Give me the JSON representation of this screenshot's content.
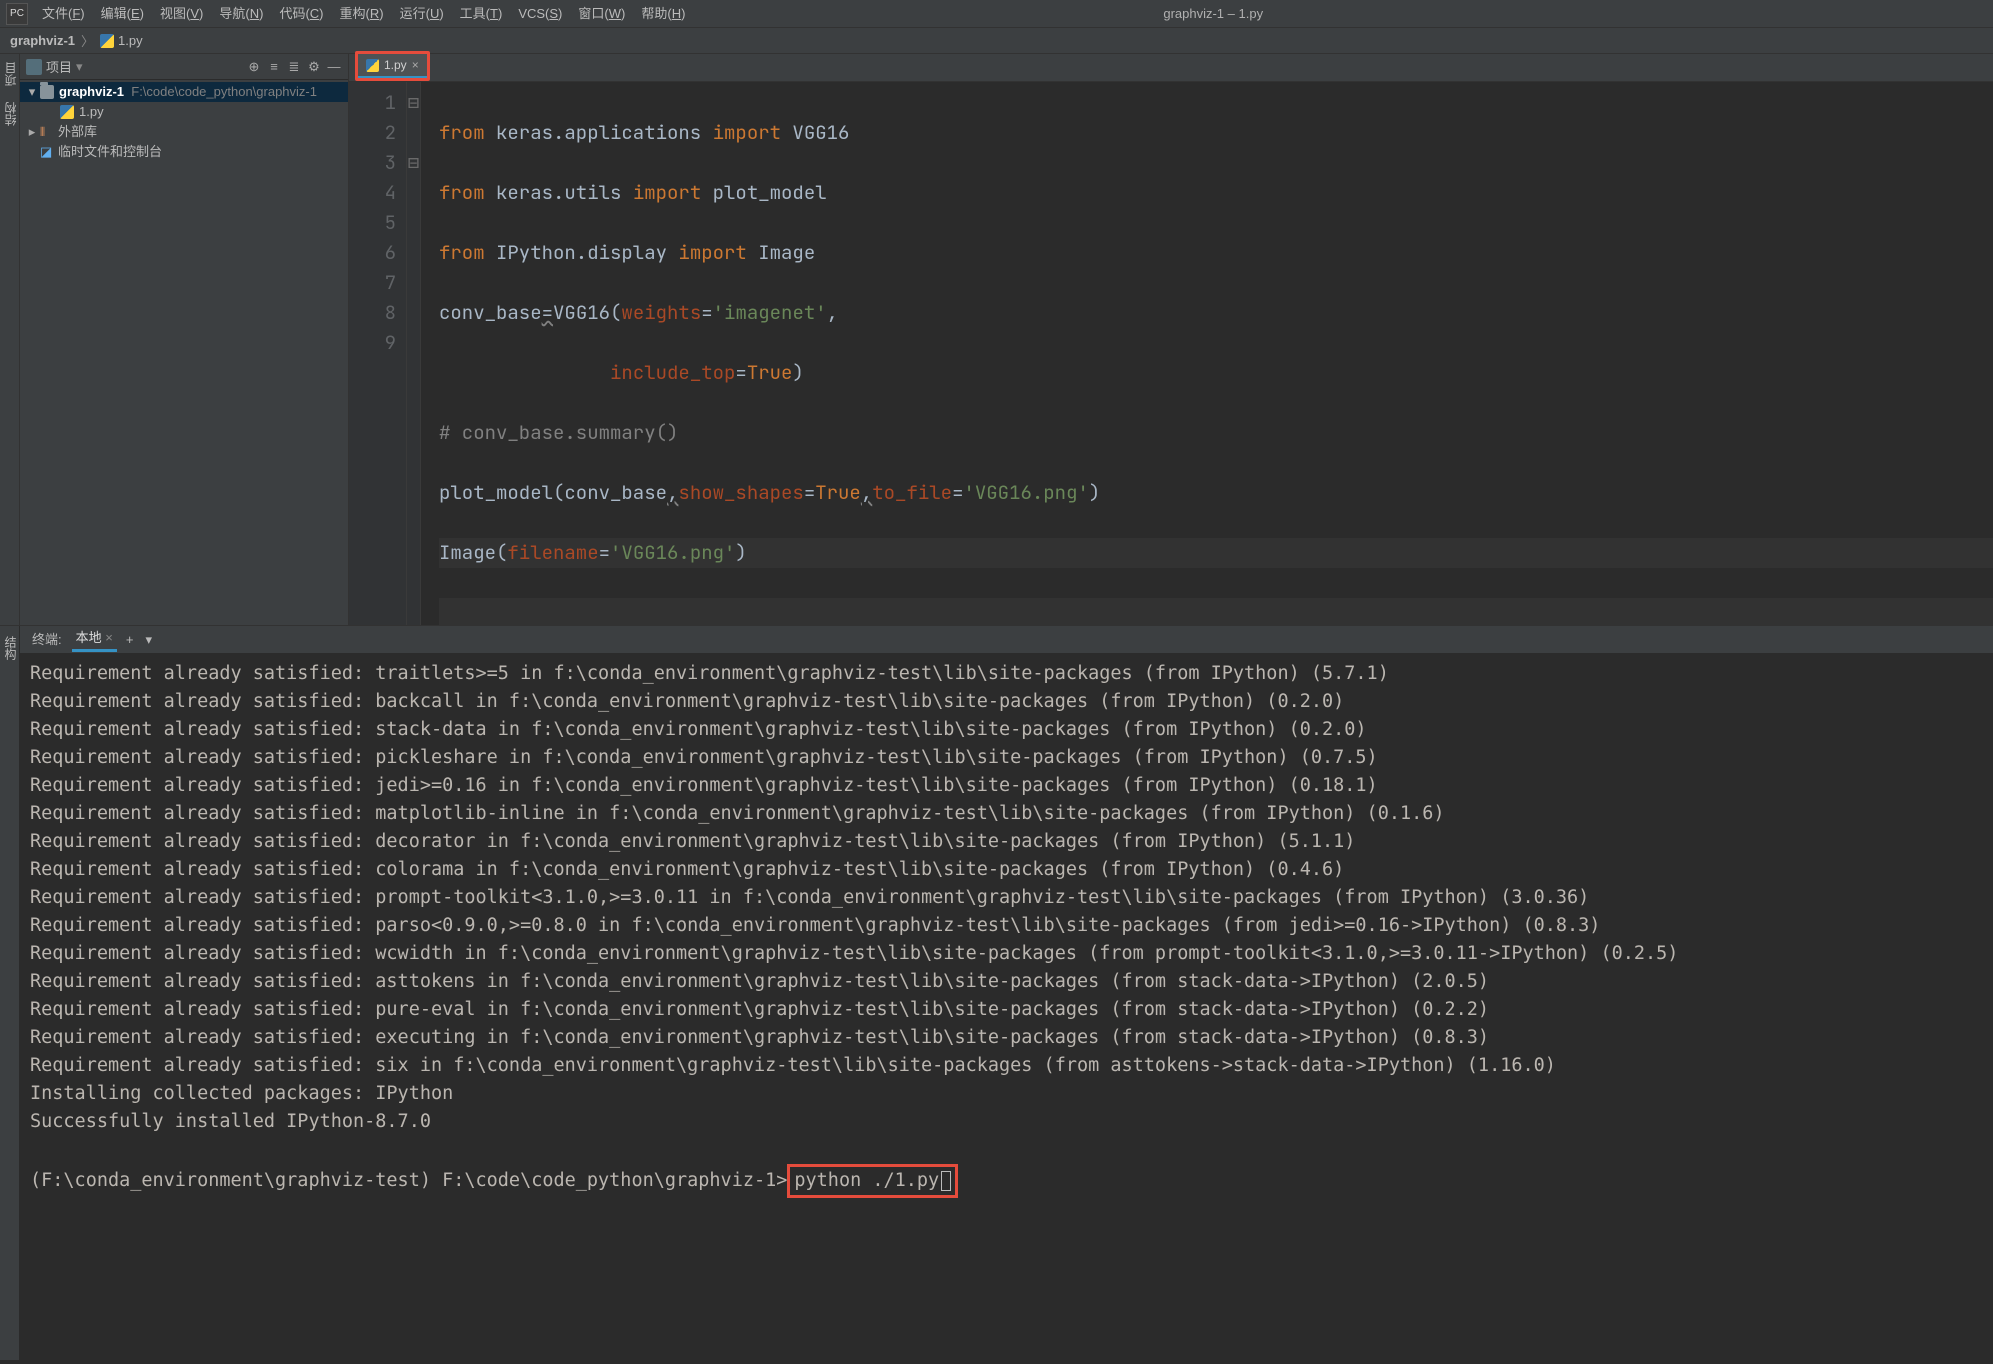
{
  "window": {
    "title": "graphviz-1 – 1.py"
  },
  "menu": {
    "items": [
      "文件(F)",
      "编辑(E)",
      "视图(V)",
      "导航(N)",
      "代码(C)",
      "重构(R)",
      "运行(U)",
      "工具(T)",
      "VCS(S)",
      "窗口(W)",
      "帮助(H)"
    ]
  },
  "breadcrumb": {
    "root": "graphviz-1",
    "file": "1.py"
  },
  "sidebar": {
    "side_strip_labels": [
      "项目",
      "结构"
    ],
    "toolbar_label": "项目",
    "project_name": "graphviz-1",
    "project_path": "F:\\code\\code_python\\graphviz-1",
    "project_file": "1.py",
    "external_libs": "外部库",
    "scratches": "临时文件和控制台"
  },
  "tab": {
    "label": "1.py"
  },
  "gutter": {
    "numbers": [
      "1",
      "2",
      "3",
      "4",
      "5",
      "6",
      "7",
      "8",
      "9"
    ]
  },
  "code": {
    "l1": {
      "a": "from",
      "b": " keras.applications ",
      "c": "import",
      "d": " VGG16"
    },
    "l2": {
      "a": "from",
      "b": " keras.utils ",
      "c": "import",
      "d": " plot_model"
    },
    "l3": {
      "a": "from",
      "b": " IPython.display ",
      "c": "import",
      "d": " Image"
    },
    "l4": {
      "a": "conv_base",
      "eq": "=",
      "b": "VGG16(",
      "p1": "weights",
      "eq2": "=",
      "s1": "'imagenet'",
      "comma": ","
    },
    "l5": {
      "pad": "               ",
      "p1": "include_top",
      "eq": "=",
      "v": "True",
      ")": ")"
    },
    "l6": {
      "c": "# conv_base.summary()"
    },
    "l7": {
      "a": "plot_model(conv_base",
      "c1": ",",
      "p1": "show_shapes",
      "eq": "=",
      "v": "True",
      "c2": ",",
      "p2": "to_file",
      "eq2": "=",
      "s": "'VGG16.png'",
      ")": ")"
    },
    "l8": {
      "a": "Image(",
      "p": "filename",
      "eq": "=",
      "s": "'VGG16.png'",
      ")": ")"
    }
  },
  "terminal": {
    "tab_main": "终端:",
    "tab_local": "本地",
    "lines": [
      "Requirement already satisfied: traitlets>=5 in f:\\conda_environment\\graphviz-test\\lib\\site-packages (from IPython) (5.7.1)",
      "Requirement already satisfied: backcall in f:\\conda_environment\\graphviz-test\\lib\\site-packages (from IPython) (0.2.0)",
      "Requirement already satisfied: stack-data in f:\\conda_environment\\graphviz-test\\lib\\site-packages (from IPython) (0.2.0)",
      "Requirement already satisfied: pickleshare in f:\\conda_environment\\graphviz-test\\lib\\site-packages (from IPython) (0.7.5)",
      "Requirement already satisfied: jedi>=0.16 in f:\\conda_environment\\graphviz-test\\lib\\site-packages (from IPython) (0.18.1)",
      "Requirement already satisfied: matplotlib-inline in f:\\conda_environment\\graphviz-test\\lib\\site-packages (from IPython) (0.1.6)",
      "Requirement already satisfied: decorator in f:\\conda_environment\\graphviz-test\\lib\\site-packages (from IPython) (5.1.1)",
      "Requirement already satisfied: colorama in f:\\conda_environment\\graphviz-test\\lib\\site-packages (from IPython) (0.4.6)",
      "Requirement already satisfied: prompt-toolkit<3.1.0,>=3.0.11 in f:\\conda_environment\\graphviz-test\\lib\\site-packages (from IPython) (3.0.36)",
      "Requirement already satisfied: parso<0.9.0,>=0.8.0 in f:\\conda_environment\\graphviz-test\\lib\\site-packages (from jedi>=0.16->IPython) (0.8.3)",
      "Requirement already satisfied: wcwidth in f:\\conda_environment\\graphviz-test\\lib\\site-packages (from prompt-toolkit<3.1.0,>=3.0.11->IPython) (0.2.5)",
      "Requirement already satisfied: asttokens in f:\\conda_environment\\graphviz-test\\lib\\site-packages (from stack-data->IPython) (2.0.5)",
      "Requirement already satisfied: pure-eval in f:\\conda_environment\\graphviz-test\\lib\\site-packages (from stack-data->IPython) (0.2.2)",
      "Requirement already satisfied: executing in f:\\conda_environment\\graphviz-test\\lib\\site-packages (from stack-data->IPython) (0.8.3)",
      "Requirement already satisfied: six in f:\\conda_environment\\graphviz-test\\lib\\site-packages (from asttokens->stack-data->IPython) (1.16.0)",
      "Installing collected packages: IPython",
      "Successfully installed IPython-8.7.0",
      ""
    ],
    "prompt_prefix": "(F:\\conda_environment\\graphviz-test) F:\\code\\code_python\\graphviz-1>",
    "prompt_cmd": "python ./1.py"
  }
}
